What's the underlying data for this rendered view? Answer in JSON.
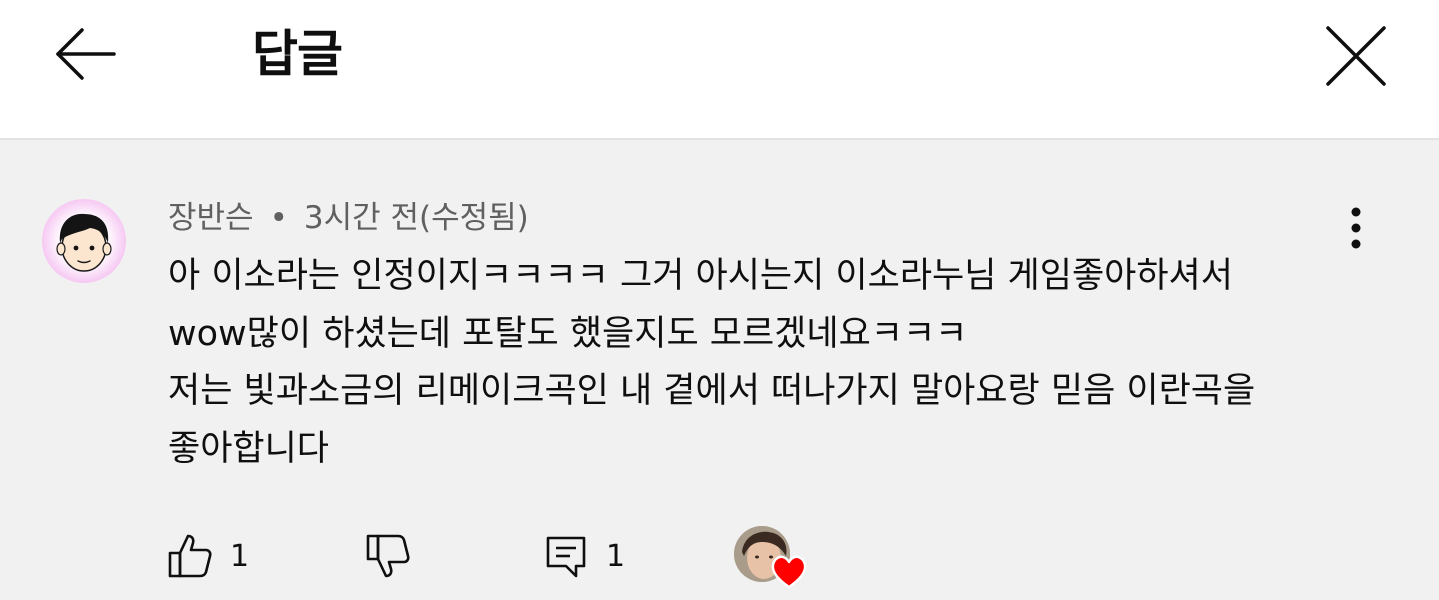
{
  "header": {
    "title": "답글",
    "back_icon": "arrow-left-icon",
    "close_icon": "close-icon"
  },
  "comment": {
    "author": "장반슨",
    "separator": "•",
    "time": "3시간 전(수정됨)",
    "lines": [
      "아 이소라는 인정이지ㅋㅋㅋㅋ 그거 아시는지 이소라누님 게임좋아하셔서",
      "wow많이 하셨는데 포탈도 했을지도 모르겠네요ㅋㅋㅋ",
      "저는 빛과소금의 리메이크곡인 내 곁에서 떠나가지 말아요랑 믿음 이란곡을",
      "좋아합니다"
    ],
    "more_icon": "more-vertical-icon"
  },
  "actions": {
    "like_count": "1",
    "reply_count": "1",
    "like_icon": "thumbs-up-icon",
    "dislike_icon": "thumbs-down-icon",
    "reply_icon": "reply-icon",
    "heart_color": "#ff0000"
  }
}
